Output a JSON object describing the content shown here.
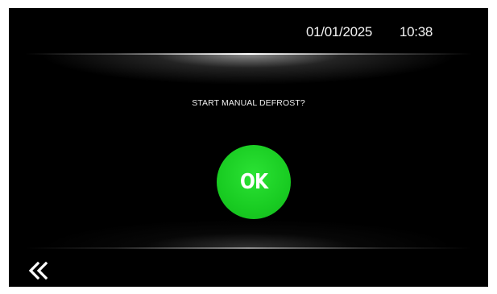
{
  "header": {
    "date": "01/01/2025",
    "time": "10:38"
  },
  "dialog": {
    "prompt": "START MANUAL DEFROST?",
    "ok_label": "OK"
  },
  "navigation": {
    "back_icon": "double-chevron-left-icon"
  },
  "colors": {
    "background": "#000000",
    "ok_button": "#19cc22",
    "text": "#ffffff"
  }
}
